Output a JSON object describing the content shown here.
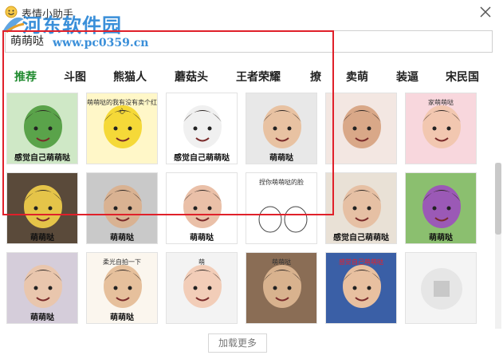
{
  "window": {
    "title": "表情小助手",
    "close_label": "×"
  },
  "watermark": {
    "text": "河东软件园",
    "url": "www.pc0359.cn"
  },
  "search": {
    "value": "萌萌哒"
  },
  "tabs": [
    "推荐",
    "斗图",
    "熊猫人",
    "蘑菇头",
    "王者荣耀",
    "撩",
    "卖萌",
    "装逼",
    "宋民国"
  ],
  "active_tab": 0,
  "stickers": [
    {
      "caption": "感觉自己萌萌哒",
      "top": "",
      "theme": "frog"
    },
    {
      "caption": "",
      "top": "萌萌哒的我有没有卖个红心",
      "theme": "pikachu"
    },
    {
      "caption": "感觉自己萌萌哒",
      "top": "",
      "theme": "bunny"
    },
    {
      "caption": "萌萌哒",
      "top": "",
      "theme": "boy"
    },
    {
      "caption": "",
      "top": "",
      "theme": "man"
    },
    {
      "caption": "",
      "top": "家萌萌哒",
      "theme": "girl"
    },
    {
      "caption": "萌萌哒",
      "top": "",
      "theme": "minion"
    },
    {
      "caption": "萌萌哒",
      "top": "",
      "theme": "baby"
    },
    {
      "caption": "萌萌哒",
      "top": "",
      "theme": "lips"
    },
    {
      "caption": "",
      "top": "捏你萌萌哒的脸",
      "theme": "sketch"
    },
    {
      "caption": "感觉自己萌萌哒",
      "top": "",
      "theme": "guy"
    },
    {
      "caption": "萌萌哒",
      "top": "",
      "theme": "teletubby"
    },
    {
      "caption": "萌萌哒",
      "top": "",
      "theme": "cat-ears"
    },
    {
      "caption": "萌萌哒",
      "top": "柔光自拍一下",
      "theme": "selfie"
    },
    {
      "caption": "",
      "top": "萌",
      "theme": "woman"
    },
    {
      "caption": "",
      "top": "萌萌哒",
      "theme": "actor"
    },
    {
      "caption": "",
      "top": "感觉自己萌萌哒",
      "theme": "singer"
    },
    {
      "caption": "",
      "top": "",
      "theme": "loading"
    }
  ],
  "load_more": "加载更多",
  "colors": {
    "accent": "#1f8a2e",
    "highlight": "#e0202a",
    "watermark": "#3a8fd9"
  }
}
